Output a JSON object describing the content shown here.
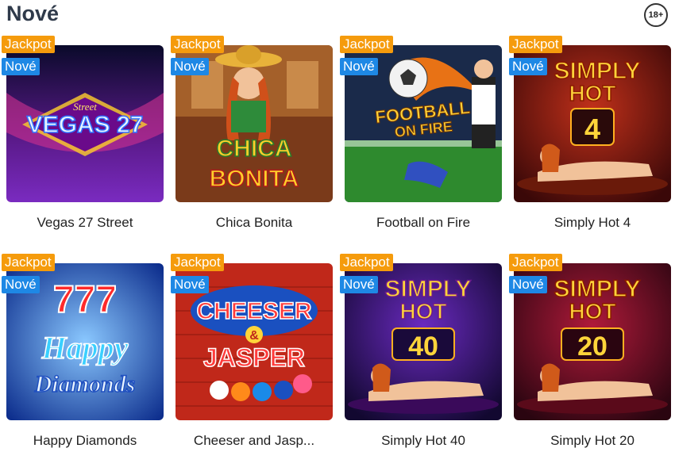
{
  "section": {
    "title": "Nové",
    "age_badge": "18+"
  },
  "badges": {
    "jackpot": "Jackpot",
    "new": "Nové"
  },
  "games": [
    {
      "name": "Vegas 27 Street",
      "logo_lines": [
        "Street",
        "VEGAS 27"
      ]
    },
    {
      "name": "Chica Bonita",
      "logo_lines": [
        "CHICA",
        "BONITA"
      ]
    },
    {
      "name": "Football on Fire",
      "logo_lines": [
        "FOOTBALL",
        "ON FIRE"
      ]
    },
    {
      "name": "Simply Hot 4",
      "logo_lines": [
        "SIMPLY",
        "HOT",
        "4"
      ]
    },
    {
      "name": "Happy Diamonds",
      "logo_lines": [
        "777",
        "Happy",
        "Diamonds"
      ]
    },
    {
      "name": "Cheeser and Jasp...",
      "logo_lines": [
        "CHEESER",
        "&",
        "JASPER"
      ]
    },
    {
      "name": "Simply Hot 40",
      "logo_lines": [
        "SIMPLY",
        "HOT",
        "40"
      ]
    },
    {
      "name": "Simply Hot 20",
      "logo_lines": [
        "SIMPLY",
        "HOT",
        "20"
      ]
    }
  ]
}
